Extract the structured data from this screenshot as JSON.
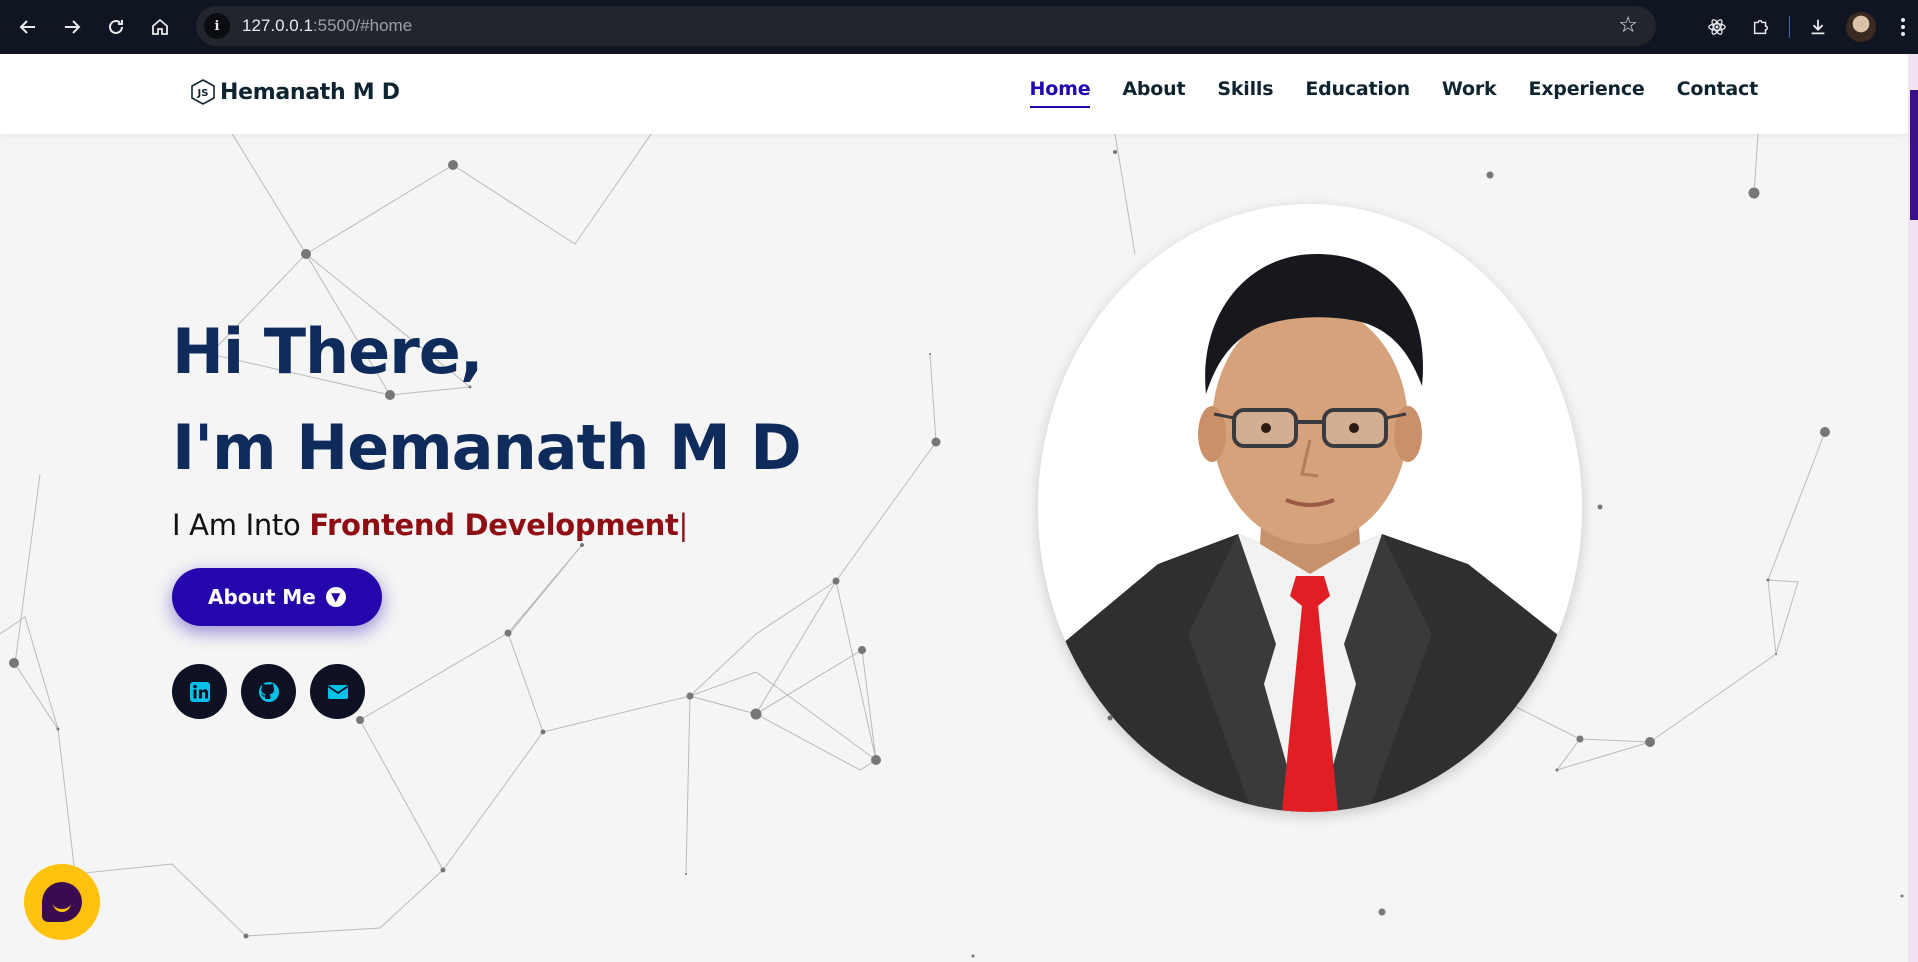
{
  "browser": {
    "url_host": "127.0.0.1",
    "url_rest": ":5500/#home",
    "icons": [
      "back-icon",
      "forward-icon",
      "reload-icon",
      "home-icon",
      "info-icon",
      "star-icon",
      "atom-extension-icon",
      "puzzle-extension-icon",
      "download-icon",
      "profile-avatar",
      "more-icon"
    ]
  },
  "site": {
    "logo_text": "Hemanath M D",
    "nav": [
      {
        "label": "Home",
        "active": true
      },
      {
        "label": "About"
      },
      {
        "label": "Skills"
      },
      {
        "label": "Education"
      },
      {
        "label": "Work"
      },
      {
        "label": "Experience"
      },
      {
        "label": "Contact"
      }
    ]
  },
  "hero": {
    "line1": "Hi There,",
    "line2": "I'm Hemanath M D",
    "typed_prefix": "I Am Into ",
    "typed_role": "Frontend Development",
    "typed_cursor": "|",
    "about_button": "About Me",
    "socials": [
      "linkedin-icon",
      "github-icon",
      "email-icon"
    ]
  },
  "colors": {
    "primary": "#2506ad",
    "heading": "#0e2b5c",
    "role": "#8e0e14",
    "chat": "#ffc20e"
  }
}
